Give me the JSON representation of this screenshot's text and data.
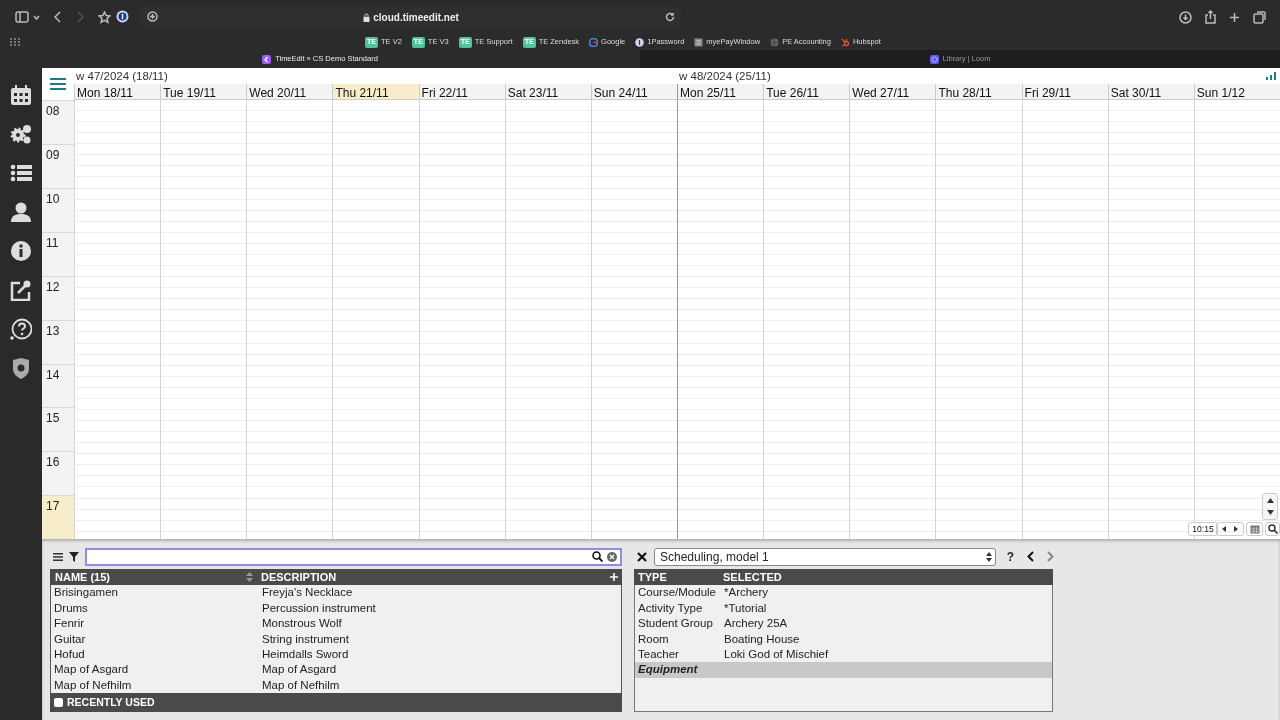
{
  "browser": {
    "url": "cloud.timeedit.net",
    "bookmarks": [
      {
        "badge": "TE",
        "label": "TE V2",
        "kind": "te"
      },
      {
        "badge": "TE",
        "label": "TE V3",
        "kind": "te"
      },
      {
        "badge": "TE",
        "label": "TE Support",
        "kind": "te"
      },
      {
        "badge": "TE",
        "label": "TE Zendesk",
        "kind": "te"
      },
      {
        "label": "Google",
        "kind": "google"
      },
      {
        "label": "1Password",
        "kind": "password"
      },
      {
        "label": "myePayWindow",
        "kind": "pay"
      },
      {
        "label": "PE Accounting",
        "kind": "globe"
      },
      {
        "label": "Hubspot",
        "kind": "hubspot"
      }
    ],
    "tabs": [
      {
        "title": "TimeEdit » CS Demo Standard",
        "selected": true,
        "kind": "timeedit"
      },
      {
        "title": "Library | Loom",
        "selected": false,
        "kind": "loom"
      }
    ]
  },
  "calendar": {
    "weeks": [
      {
        "label": "w 47/2024 (18/11)",
        "days": [
          {
            "label": "Mon 18/11",
            "today": false
          },
          {
            "label": "Tue 19/11",
            "today": false
          },
          {
            "label": "Wed 20/11",
            "today": false
          },
          {
            "label": "Thu 21/11",
            "today": true
          },
          {
            "label": "Fri 22/11",
            "today": false
          },
          {
            "label": "Sat 23/11",
            "today": false
          },
          {
            "label": "Sun 24/11",
            "today": false
          }
        ]
      },
      {
        "label": "w 48/2024 (25/11)",
        "days": [
          {
            "label": "Mon 25/11",
            "today": false
          },
          {
            "label": "Tue 26/11",
            "today": false
          },
          {
            "label": "Wed 27/11",
            "today": false
          },
          {
            "label": "Thu 28/11",
            "today": false
          },
          {
            "label": "Fri 29/11",
            "today": false
          },
          {
            "label": "Sat 30/11",
            "today": false
          },
          {
            "label": "Sun 1/12",
            "today": false
          }
        ]
      }
    ],
    "hours": [
      {
        "label": "08",
        "current": false
      },
      {
        "label": "09",
        "current": false
      },
      {
        "label": "10",
        "current": false
      },
      {
        "label": "11",
        "current": false
      },
      {
        "label": "12",
        "current": false
      },
      {
        "label": "13",
        "current": false
      },
      {
        "label": "14",
        "current": false
      },
      {
        "label": "15",
        "current": false
      },
      {
        "label": "16",
        "current": false
      },
      {
        "label": "17",
        "current": true
      }
    ],
    "time": "10:15"
  },
  "objects": {
    "columns": [
      "NAME (15)",
      "DESCRIPTION"
    ],
    "rows": [
      {
        "name": "Brisingamen",
        "description": "Freyja's Necklace"
      },
      {
        "name": "Drums",
        "description": "Percussion instrument"
      },
      {
        "name": "Fenrir",
        "description": "Monstrous Wolf"
      },
      {
        "name": "Guitar",
        "description": "String instrument"
      },
      {
        "name": "Hofud",
        "description": "Heimdalls Sword"
      },
      {
        "name": "Map of Asgard",
        "description": "Map of Asgard"
      },
      {
        "name": "Map of Nefhilm",
        "description": "Map of Nefhilm"
      }
    ],
    "recently_used": {
      "label": "RECENTLY USED",
      "checked": false
    }
  },
  "selection": {
    "model": "Scheduling, model 1",
    "help": "?",
    "columns": [
      "TYPE",
      "SELECTED"
    ],
    "rows": [
      {
        "type": "Course/Module",
        "selected": "*Archery",
        "active": false
      },
      {
        "type": "Activity Type",
        "selected": "*Tutorial",
        "active": false
      },
      {
        "type": "Student Group",
        "selected": "Archery 25A",
        "active": false
      },
      {
        "type": "Room",
        "selected": "Boating House",
        "active": false
      },
      {
        "type": "Teacher",
        "selected": "Loki God of Mischief",
        "active": false
      },
      {
        "type": "Equipment",
        "active": true
      }
    ]
  }
}
